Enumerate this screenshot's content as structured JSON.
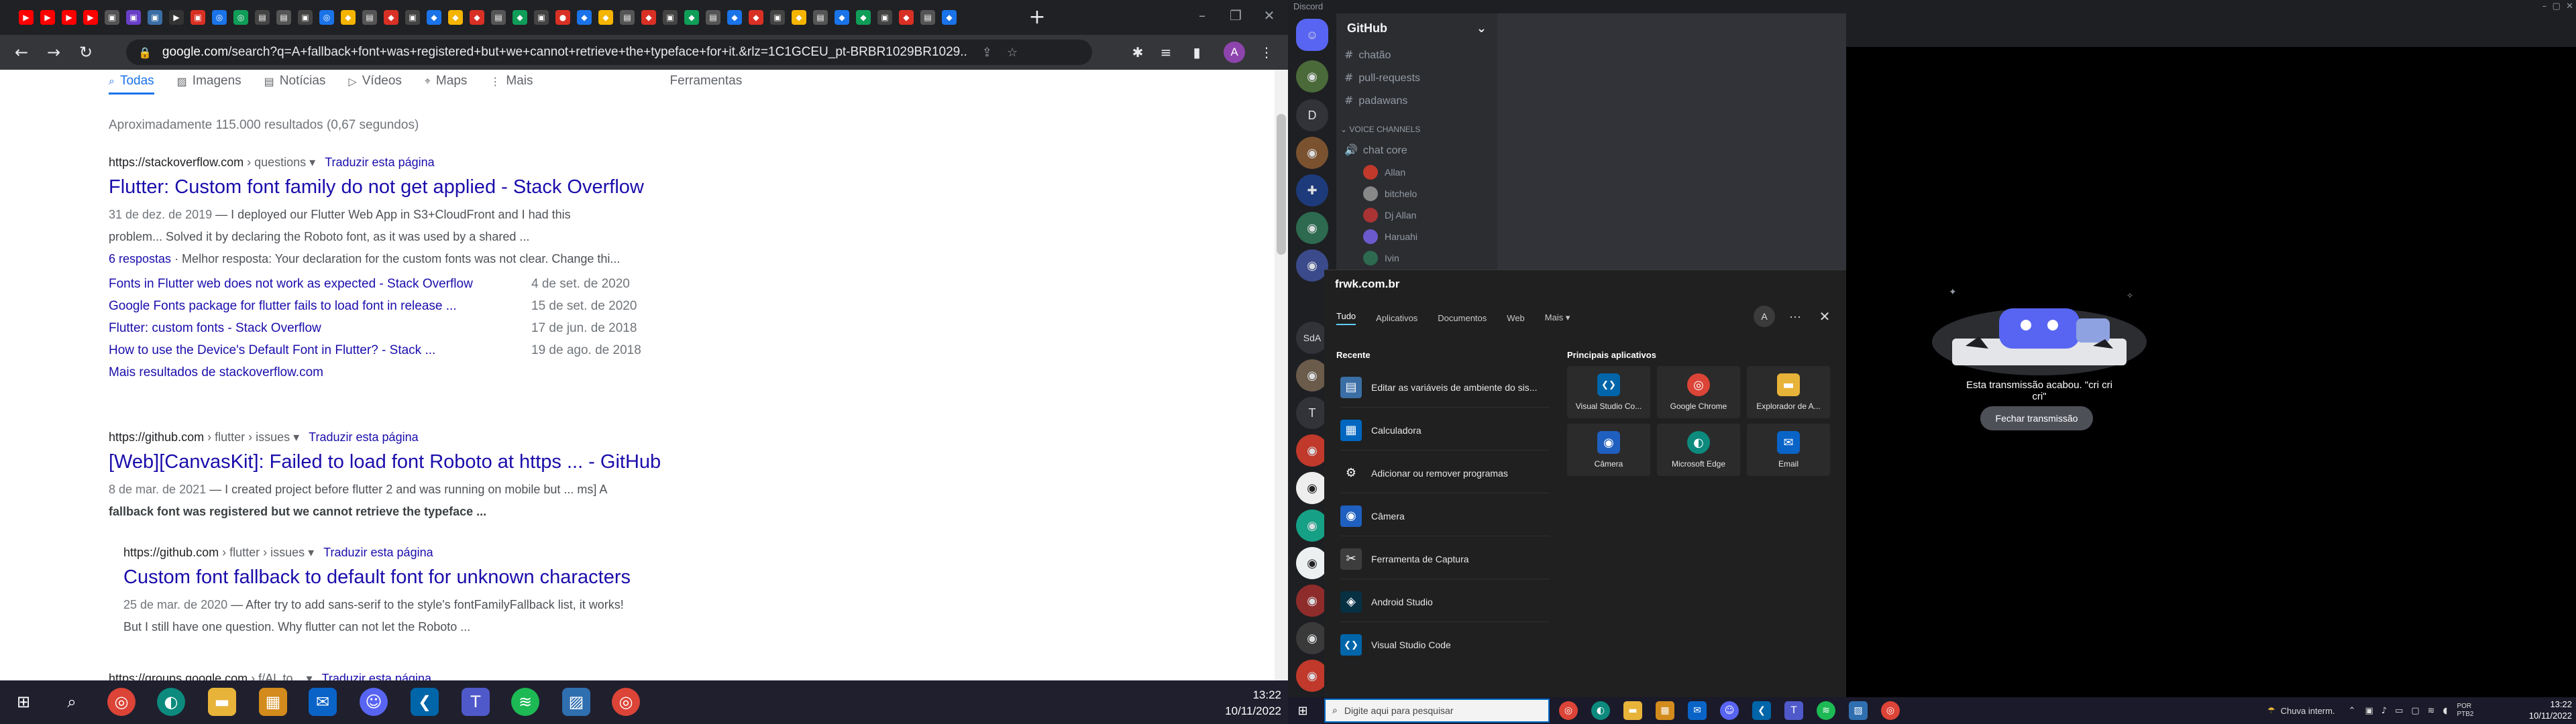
{
  "browser": {
    "url_host": "google.com",
    "url_rest": "/search?q=A+fallback+font+was+registered+but+we+cannot+retrieve+the+typeface+for+it.&rlz=1C1GCEU_pt-BRBR1029BR1029...",
    "new_tab": "+",
    "profile_initial": "A"
  },
  "google": {
    "tabs": [
      {
        "label": "Todas",
        "icon": "search-icon"
      },
      {
        "label": "Imagens",
        "icon": "image-icon"
      },
      {
        "label": "Notícias",
        "icon": "news-icon"
      },
      {
        "label": "Vídeos",
        "icon": "video-icon"
      },
      {
        "label": "Maps",
        "icon": "map-pin-icon"
      },
      {
        "label": "Mais",
        "icon": "more-vert-icon"
      },
      {
        "label": "Ferramentas",
        "icon": ""
      }
    ],
    "stats": "Aproximadamente 115.000 resultados (0,67 segundos)",
    "results": [
      {
        "site": "https://stackoverflow.com",
        "crumb": " › questions",
        "translate": "Traduzir esta página",
        "title": "Flutter: Custom font family do not get applied - Stack Overflow",
        "date": "31 de dez. de 2019",
        "snippet1": " — I deployed our Flutter Web App in S3+CloudFront and I had this",
        "snippet2": "problem... Solved it by declaring the Roboto font, as it was used by a shared ...",
        "answers": "6 respostas",
        "best": " · Melhor resposta: Your declaration for the custom fonts was not clear. Change thi...",
        "sublinks": [
          {
            "label": "Fonts in Flutter web does not work as expected - Stack Overflow",
            "date": "4 de set. de 2020"
          },
          {
            "label": "Google Fonts package for flutter fails to load font in release ...",
            "date": "15 de set. de 2020"
          },
          {
            "label": "Flutter: custom fonts - Stack Overflow",
            "date": "17 de jun. de 2018"
          },
          {
            "label": "How to use the Device's Default Font in Flutter? - Stack ...",
            "date": "19 de ago. de 2018"
          }
        ],
        "more": "Mais resultados de stackoverflow.com"
      },
      {
        "site": "https://github.com",
        "crumb": " › flutter › issues",
        "translate": "Traduzir esta página",
        "title": "[Web][CanvasKit]: Failed to load font Roboto at https ... - GitHub",
        "date": "8 de mar. de 2021",
        "snippet1": " — I created project before flutter 2 and was running on mobile but ... ms] A",
        "snippet2": "fallback font was registered but we cannot retrieve the typeface ..."
      },
      {
        "site": "https://github.com",
        "crumb": " › flutter › issues",
        "translate": "Traduzir esta página",
        "title": "Custom font fallback to default font for unknown characters",
        "date": "25 de mar. de 2020",
        "snippet1": " — After try to add sans-serif to the style's fontFamilyFallback list, it works!",
        "snippet2": "But I still have one question. Why flutter can not let the Roboto ..."
      },
      {
        "site": "https://groups.google.com",
        "crumb": " › f/AL to...",
        "translate": "Traduzir esta página"
      }
    ]
  },
  "taskbar1": {
    "time": "13:22",
    "date": "10/11/2022"
  },
  "discord": {
    "app_title": "Discord",
    "server": "GitHub",
    "channels": [
      "chatão",
      "pull-requests",
      "padawans"
    ],
    "voice_header": "VOICE CHANNELS",
    "voice_channel": "chat core",
    "voice_users": [
      "Allan",
      "bitchelo",
      "Dj Allan",
      "Haruahi",
      "Ivin"
    ],
    "guild_letters": [
      "D",
      "T",
      "SdA"
    ],
    "stream_end": "Esta transmissão acabou. \"cri cri cri\"",
    "close_stream": "Fechar transmissão"
  },
  "startmenu": {
    "header": "frwk.com.br",
    "tabs": [
      "Tudo",
      "Aplicativos",
      "Documentos",
      "Web",
      "Mais"
    ],
    "avatar": "A",
    "recent_label": "Recente",
    "recent": [
      {
        "label": "Editar as variáveis de ambiente do sis...",
        "icon": "env-vars-icon",
        "color": "#3a6ea5",
        "glyph": "▤"
      },
      {
        "label": "Calculadora",
        "icon": "calculator-icon",
        "color": "#0067c0",
        "glyph": "▦"
      },
      {
        "label": "Adicionar ou remover programas",
        "icon": "gear-icon",
        "color": "#202020",
        "glyph": "⚙"
      },
      {
        "label": "Câmera",
        "icon": "camera-icon",
        "color": "#1f5fbf",
        "glyph": "◉"
      },
      {
        "label": "Ferramenta de Captura",
        "icon": "snip-icon",
        "color": "#3d3d3d",
        "glyph": "✂"
      },
      {
        "label": "Android Studio",
        "icon": "android-studio-icon",
        "color": "#073042",
        "glyph": "◈"
      },
      {
        "label": "Visual Studio Code",
        "icon": "vscode-icon",
        "color": "#0065a9",
        "glyph": "❮❯"
      }
    ],
    "top_label": "Principais aplicativos",
    "top_apps": [
      {
        "label": "Visual Studio Co...",
        "icon": "vscode-icon",
        "color": "#0065a9",
        "glyph": "❮❯"
      },
      {
        "label": "Google Chrome",
        "icon": "chrome-icon",
        "color": "#db4437",
        "glyph": "◎"
      },
      {
        "label": "Explorador de A...",
        "icon": "folder-icon",
        "color": "#e8b339",
        "glyph": "▬"
      },
      {
        "label": "Câmera",
        "icon": "camera-icon",
        "color": "#1f5fbf",
        "glyph": "◉"
      },
      {
        "label": "Microsoft Edge",
        "icon": "edge-icon",
        "color": "#0c8a7d",
        "glyph": "◐"
      },
      {
        "label": "Email",
        "icon": "mail-icon",
        "color": "#0a64c8",
        "glyph": "✉"
      }
    ]
  },
  "taskbar2": {
    "search_placeholder": "Digite aqui para pesquisar",
    "weather": "Chuva interm.",
    "lang": "POR",
    "lang2": "PTB2",
    "time": "13:22",
    "date": "10/11/2022"
  }
}
